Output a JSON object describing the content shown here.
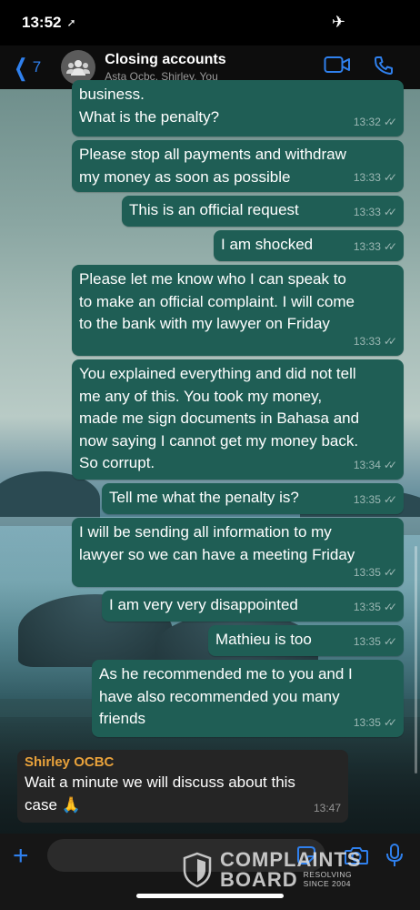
{
  "status_bar": {
    "time": "13:52",
    "location_glyph": "➚",
    "airplane_glyph": "✈"
  },
  "header": {
    "back_count": "7",
    "title": "Closing accounts",
    "subtitle": "Asta Ocbc, Shirley, You"
  },
  "messages": [
    {
      "text": "business.\nWhat is the penalty?",
      "time": "13:32"
    },
    {
      "text": "Please stop all payments and withdraw\nmy money as soon as possible",
      "time": "13:33"
    },
    {
      "text": "This is an official request",
      "time": "13:33"
    },
    {
      "text": "I am shocked",
      "time": "13:33"
    },
    {
      "text": "Please let me know who I can speak to\nto make an official complaint. I will come\nto the bank with my lawyer on Friday",
      "time": "13:33"
    },
    {
      "text": "You explained everything and did not tell\nme any of this. You took my money,\nmade me sign documents in Bahasa and\nnow saying I cannot get my money back.\nSo corrupt.",
      "time": "13:34"
    },
    {
      "text": "Tell me what the penalty is?",
      "time": "13:35"
    },
    {
      "text": "I will be sending all information to my\nlawyer so we can have a meeting Friday",
      "time": "13:35"
    },
    {
      "text": "I am very very disappointed",
      "time": "13:35"
    },
    {
      "text": "Mathieu is too",
      "time": "13:35"
    },
    {
      "text": "As he recommended me to you and I\nhave also recommended you many\nfriends",
      "time": "13:35"
    }
  ],
  "incoming": {
    "sender": "Shirley OCBC",
    "text": "Wait a minute we will discuss about this\ncase 🙏",
    "time": "13:47"
  },
  "input": {
    "placeholder": ""
  },
  "watermark": {
    "line1": "COMPLAINTS",
    "line2": "BOARD",
    "small1": "RESOLVING",
    "small2": "SINCE 2004"
  },
  "colors": {
    "outgoing_bubble": "#1f5e55",
    "incoming_bubble": "#252525",
    "accent_blue": "#2f80ed",
    "sender_name": "#e9a23b"
  }
}
